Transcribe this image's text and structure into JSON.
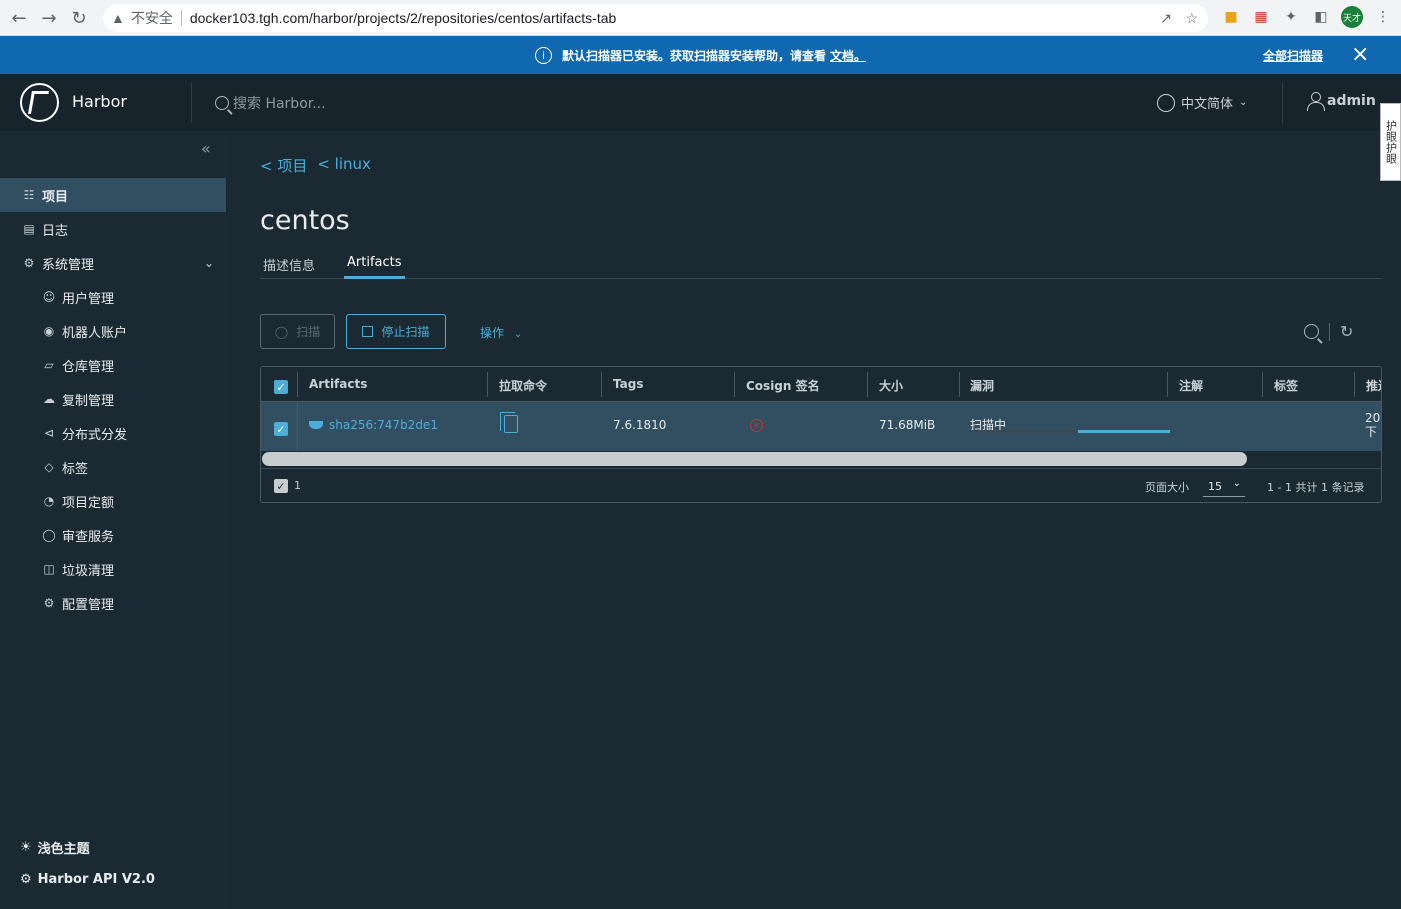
{
  "browser": {
    "insecure_label": "不安全",
    "url": "docker103.tgh.com/harbor/projects/2/repositories/centos/artifacts-tab",
    "profile_label": "天才"
  },
  "banner": {
    "message": "默认扫描器已安装。获取扫描器安装帮助，请查看",
    "doc_link": "文档。",
    "all_scanners": "全部扫描器"
  },
  "header": {
    "brand": "Harbor",
    "search_placeholder": "搜索 Harbor...",
    "language": "中文简体",
    "user": "admin",
    "side_tab": "护眼护眼"
  },
  "sidebar": {
    "items": [
      {
        "label": "项目",
        "icon": "projects-icon"
      },
      {
        "label": "日志",
        "icon": "logs-icon"
      },
      {
        "label": "系统管理",
        "icon": "admin-icon"
      }
    ],
    "sub_items": [
      {
        "label": "用户管理",
        "icon": "users-icon"
      },
      {
        "label": "机器人账户",
        "icon": "robot-icon"
      },
      {
        "label": "仓库管理",
        "icon": "registry-icon"
      },
      {
        "label": "复制管理",
        "icon": "replication-icon"
      },
      {
        "label": "分布式分发",
        "icon": "distribution-icon"
      },
      {
        "label": "标签",
        "icon": "tag-icon"
      },
      {
        "label": "项目定额",
        "icon": "quota-icon"
      },
      {
        "label": "审查服务",
        "icon": "shield-icon"
      },
      {
        "label": "垃圾清理",
        "icon": "trash-icon"
      },
      {
        "label": "配置管理",
        "icon": "gear-icon"
      }
    ],
    "theme": "浅色主题",
    "api": "Harbor API V2.0"
  },
  "main": {
    "breadcrumb": [
      "< 项目",
      "< linux"
    ],
    "title": "centos",
    "tabs": [
      "描述信息",
      "Artifacts"
    ],
    "buttons": {
      "scan": "扫描",
      "stop_scan": "停止扫描",
      "actions": "操作"
    },
    "table": {
      "headers": [
        "Artifacts",
        "拉取命令",
        "Tags",
        "Cosign 签名",
        "大小",
        "漏洞",
        "注解",
        "标签",
        "推送"
      ],
      "row": {
        "digest": "sha256:747b2de1",
        "tag": "7.6.1810",
        "size": "71.68MiB",
        "vuln_status": "扫描中",
        "push_time_line1": "20",
        "push_time_line2": "下"
      },
      "footer": {
        "selected_count": "1",
        "page_size_label": "页面大小",
        "page_size": "15",
        "summary": "1 - 1 共计 1 条记录"
      }
    }
  },
  "colors": {
    "accent": "#4aaed9",
    "banner": "#0f68b0",
    "bg": "#1b2a32",
    "row_selected": "#324f61",
    "danger": "#c4362d"
  }
}
